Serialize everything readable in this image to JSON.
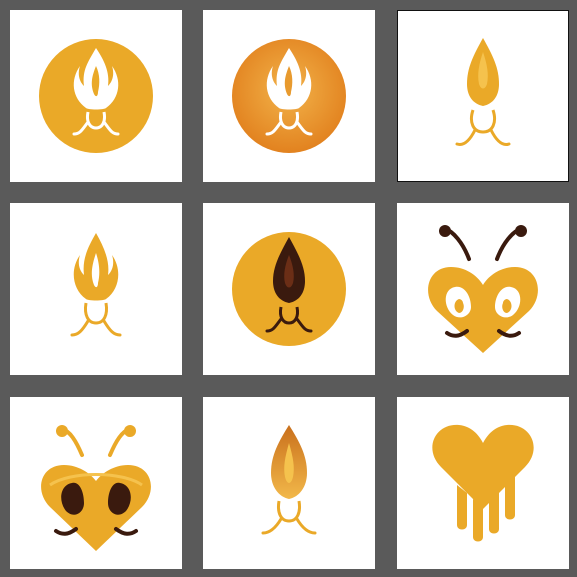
{
  "canvas": {
    "background": "#5a5a5a",
    "tile_background": "#ffffff",
    "accent_gold": "#eaa928",
    "accent_orange": "#e2821f",
    "accent_dark": "#3a1a0e"
  },
  "tiles": [
    {
      "id": "t1",
      "motif": "flame-icon",
      "variant": "white flame on gold circle",
      "selected": false
    },
    {
      "id": "t2",
      "motif": "flame-icon",
      "variant": "white flame on orange gradient circle",
      "selected": false
    },
    {
      "id": "t3",
      "motif": "flame-icon",
      "variant": "gold flame on white",
      "selected": true
    },
    {
      "id": "t4",
      "motif": "flame-icon",
      "variant": "gold outline flame on white",
      "selected": false
    },
    {
      "id": "t5",
      "motif": "flame-icon",
      "variant": "dark flame on gold circle",
      "selected": false
    },
    {
      "id": "t6",
      "motif": "bee-heart-icon",
      "variant": "gold heart bee with antennae",
      "selected": false
    },
    {
      "id": "t7",
      "motif": "bee-heart-icon",
      "variant": "gold heart bee with dark eyes",
      "selected": false
    },
    {
      "id": "t8",
      "motif": "flame-icon",
      "variant": "gradient flame on white",
      "selected": false
    },
    {
      "id": "t9",
      "motif": "dripping-heart-icon",
      "variant": "gold dripping heart",
      "selected": false
    }
  ]
}
